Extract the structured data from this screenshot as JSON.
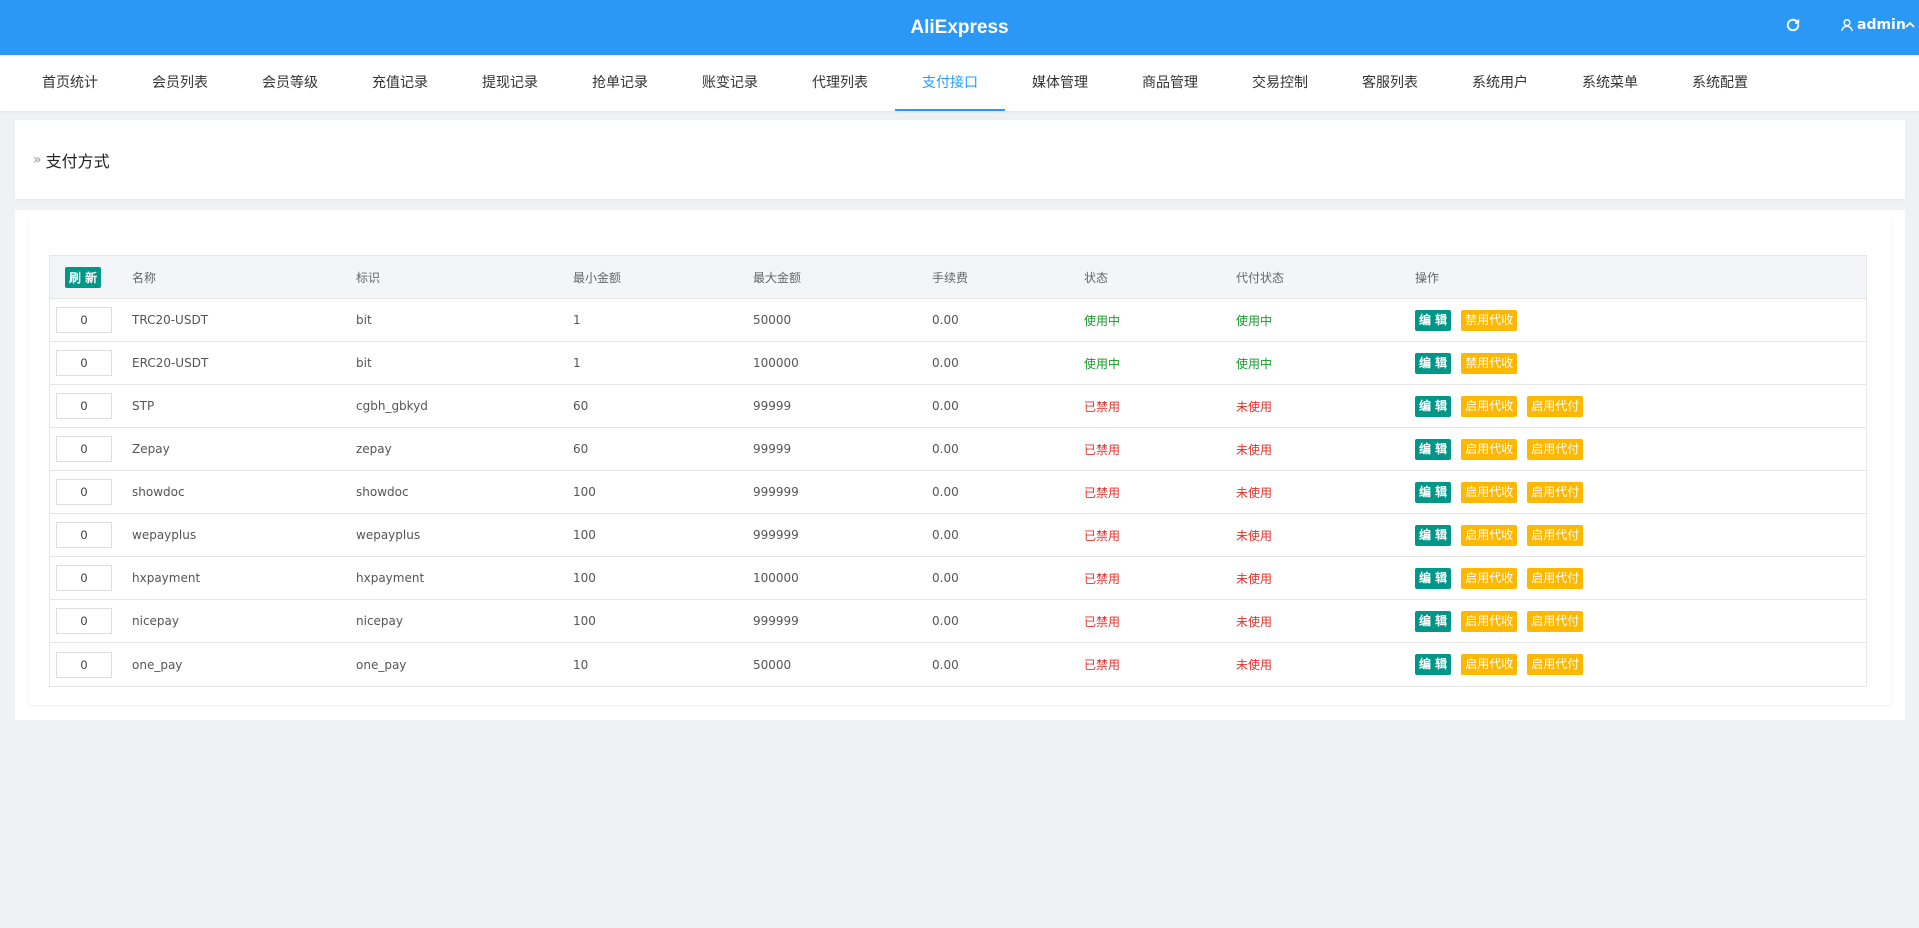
{
  "app": {
    "title": "AliExpress",
    "user": "admin"
  },
  "nav": [
    {
      "label": "首页统计"
    },
    {
      "label": "会员列表"
    },
    {
      "label": "会员等级"
    },
    {
      "label": "充值记录"
    },
    {
      "label": "提现记录"
    },
    {
      "label": "抢单记录"
    },
    {
      "label": "账变记录"
    },
    {
      "label": "代理列表"
    },
    {
      "label": "支付接口",
      "active": true
    },
    {
      "label": "媒体管理"
    },
    {
      "label": "商品管理"
    },
    {
      "label": "交易控制"
    },
    {
      "label": "客服列表"
    },
    {
      "label": "系统用户"
    },
    {
      "label": "系统菜单"
    },
    {
      "label": "系统配置"
    }
  ],
  "page": {
    "chevron": "»",
    "title": "支付方式"
  },
  "table": {
    "refresh_label": "刷 新",
    "headers": {
      "name": "名称",
      "code": "标识",
      "min": "最小金额",
      "max": "最大金额",
      "fee": "手续费",
      "status": "状态",
      "payout_status": "代付状态",
      "actions": "操作"
    },
    "rows": [
      {
        "sort": "0",
        "name": "TRC20-USDT",
        "code": "bit",
        "min": "1",
        "max": "50000",
        "fee": "0.00",
        "status": "使用中",
        "status_ok": true,
        "payout": "使用中",
        "payout_ok": true,
        "actions": [
          "编 辑",
          "禁用代收"
        ]
      },
      {
        "sort": "0",
        "name": "ERC20-USDT",
        "code": "bit",
        "min": "1",
        "max": "100000",
        "fee": "0.00",
        "status": "使用中",
        "status_ok": true,
        "payout": "使用中",
        "payout_ok": true,
        "actions": [
          "编 辑",
          "禁用代收"
        ]
      },
      {
        "sort": "0",
        "name": "STP",
        "code": "cgbh_gbkyd",
        "min": "60",
        "max": "99999",
        "fee": "0.00",
        "status": "已禁用",
        "status_ok": false,
        "payout": "未使用",
        "payout_ok": false,
        "actions": [
          "编 辑",
          "启用代收",
          "启用代付"
        ]
      },
      {
        "sort": "0",
        "name": "Zepay",
        "code": "zepay",
        "min": "60",
        "max": "99999",
        "fee": "0.00",
        "status": "已禁用",
        "status_ok": false,
        "payout": "未使用",
        "payout_ok": false,
        "actions": [
          "编 辑",
          "启用代收",
          "启用代付"
        ]
      },
      {
        "sort": "0",
        "name": "showdoc",
        "code": "showdoc",
        "min": "100",
        "max": "999999",
        "fee": "0.00",
        "status": "已禁用",
        "status_ok": false,
        "payout": "未使用",
        "payout_ok": false,
        "actions": [
          "编 辑",
          "启用代收",
          "启用代付"
        ]
      },
      {
        "sort": "0",
        "name": "wepayplus",
        "code": "wepayplus",
        "min": "100",
        "max": "999999",
        "fee": "0.00",
        "status": "已禁用",
        "status_ok": false,
        "payout": "未使用",
        "payout_ok": false,
        "actions": [
          "编 辑",
          "启用代收",
          "启用代付"
        ]
      },
      {
        "sort": "0",
        "name": "hxpayment",
        "code": "hxpayment",
        "min": "100",
        "max": "100000",
        "fee": "0.00",
        "status": "已禁用",
        "status_ok": false,
        "payout": "未使用",
        "payout_ok": false,
        "actions": [
          "编 辑",
          "启用代收",
          "启用代付"
        ]
      },
      {
        "sort": "0",
        "name": "nicepay",
        "code": "nicepay",
        "min": "100",
        "max": "999999",
        "fee": "0.00",
        "status": "已禁用",
        "status_ok": false,
        "payout": "未使用",
        "payout_ok": false,
        "actions": [
          "编 辑",
          "启用代收",
          "启用代付"
        ]
      },
      {
        "sort": "0",
        "name": "one_pay",
        "code": "one_pay",
        "min": "10",
        "max": "50000",
        "fee": "0.00",
        "status": "已禁用",
        "status_ok": false,
        "payout": "未使用",
        "payout_ok": false,
        "actions": [
          "编 辑",
          "启用代收",
          "启用代付"
        ]
      }
    ]
  },
  "colors": {
    "header_bg": "#2b98f5",
    "accent": "#1e9fff",
    "button_primary": "#009688",
    "button_warn": "#ffb800",
    "status_ok": "#159b2a",
    "status_bad": "#e4302b"
  },
  "icons": {
    "refresh": "refresh-icon",
    "user": "user-icon",
    "chevron": "chevron-up-icon"
  }
}
